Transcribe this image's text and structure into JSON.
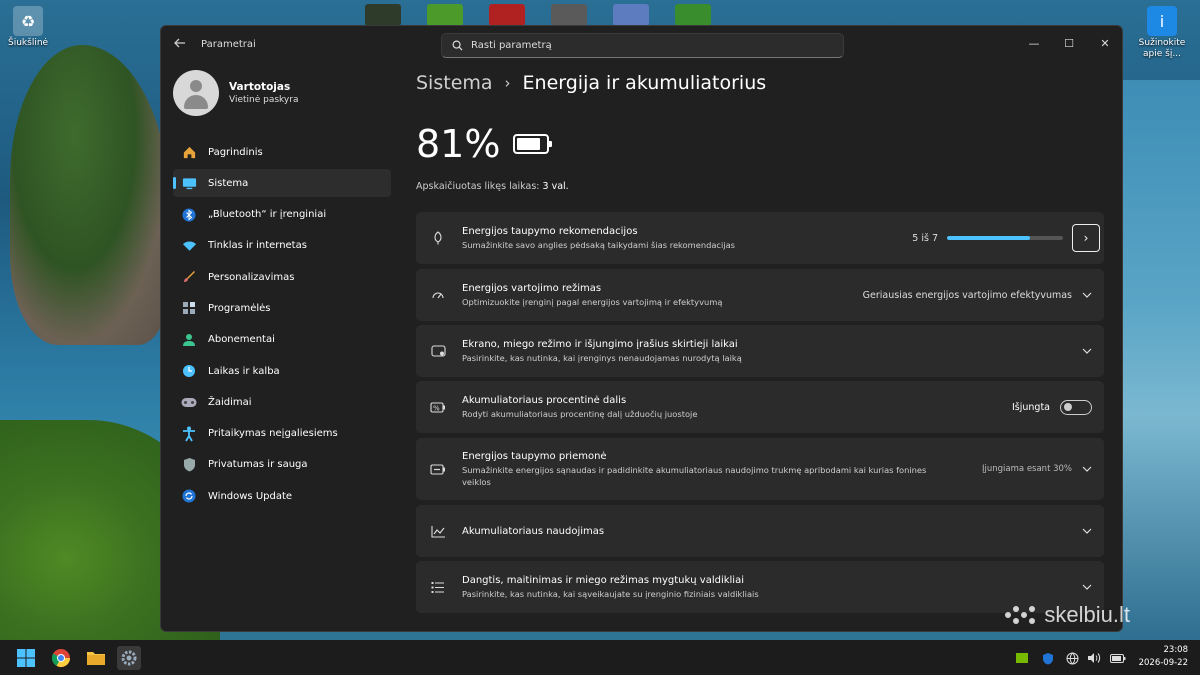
{
  "desktop": {
    "icons": [
      {
        "label": "Šiukšlinė",
        "icon": "recycle-bin-icon"
      },
      {
        "label": "Sužinokite\napie šį...",
        "icon": "learn-about-picture-icon"
      }
    ],
    "watermark": "skelbiu.lt"
  },
  "window": {
    "app_title": "Parametrai",
    "search_placeholder": "Rasti parametrą",
    "controls": {
      "minimize": "—",
      "maximize": "☐",
      "close": "✕"
    }
  },
  "user": {
    "name": "Vartotojas",
    "account_type": "Vietinė paskyra"
  },
  "sidebar": {
    "items": [
      {
        "label": "Pagrindinis",
        "icon": "home-icon",
        "active": false
      },
      {
        "label": "Sistema",
        "icon": "system-icon",
        "active": true
      },
      {
        "label": "„Bluetooth“ ir įrenginiai",
        "icon": "bluetooth-icon",
        "active": false
      },
      {
        "label": "Tinklas ir internetas",
        "icon": "wifi-icon",
        "active": false
      },
      {
        "label": "Personalizavimas",
        "icon": "brush-icon",
        "active": false
      },
      {
        "label": "Programėlės",
        "icon": "apps-icon",
        "active": false
      },
      {
        "label": "Abonementai",
        "icon": "accounts-icon",
        "active": false
      },
      {
        "label": "Laikas ir kalba",
        "icon": "time-language-icon",
        "active": false
      },
      {
        "label": "Žaidimai",
        "icon": "gaming-icon",
        "active": false
      },
      {
        "label": "Pritaikymas neįgaliesiems",
        "icon": "accessibility-icon",
        "active": false
      },
      {
        "label": "Privatumas ir sauga",
        "icon": "shield-icon",
        "active": false
      },
      {
        "label": "Windows Update",
        "icon": "update-icon",
        "active": false
      }
    ]
  },
  "breadcrumb": {
    "parent": "Sistema",
    "separator": "›",
    "current": "Energija ir akumuliatorius"
  },
  "battery": {
    "percent_text": "81%",
    "percent": 81,
    "estimate_label": "Apskaičiuotas likęs laikas:",
    "estimate_value": "3 val."
  },
  "cards": {
    "recommendations": {
      "title": "Energijos taupymo rekomendacijos",
      "subtitle": "Sumažinkite savo anglies pėdsaką taikydami šias rekomendacijas",
      "progress_text": "5 iš 7",
      "progress_done": 5,
      "progress_total": 7,
      "arrow": "›"
    },
    "power_mode": {
      "title": "Energijos vartojimo režimas",
      "subtitle": "Optimizuokite įrenginį pagal energijos vartojimą ir efektyvumą",
      "value": "Geriausias energijos vartojimo efektyvumas"
    },
    "screen_sleep": {
      "title": "Ekrano, miego režimo ir išjungimo įrašius skirtieji laikai",
      "subtitle": "Pasirinkite, kas nutinka, kai įrenginys nenaudojamas nurodytą laiką"
    },
    "battery_percent": {
      "title": "Akumuliatoriaus procentinė dalis",
      "subtitle": "Rodyti akumuliatoriaus procentinę dalį užduočių juostoje",
      "toggle_label": "Išjungta",
      "toggle_on": false
    },
    "energy_saver": {
      "title": "Energijos taupymo priemonė",
      "subtitle": "Sumažinkite energijos sąnaudas ir padidinkite akumuliatoriaus naudojimo trukmę apribodami kai kurias fonines veiklos",
      "value": "Įjungiama esant 30%"
    },
    "battery_usage": {
      "title": "Akumuliatoriaus naudojimas"
    },
    "lid_power": {
      "title": "Dangtis, maitinimas ir miego režimas mygtukų valdikliai",
      "subtitle": "Pasirinkite, kas nutinka, kai sąveikaujate su įrenginio fiziniais valdikliais"
    }
  },
  "taskbar": {
    "clock_time": "23:08",
    "clock_date": "2026-09-22"
  },
  "colors": {
    "accent": "#4cc2ff",
    "window_bg": "#202020",
    "card_bg": "#2b2b2b"
  }
}
